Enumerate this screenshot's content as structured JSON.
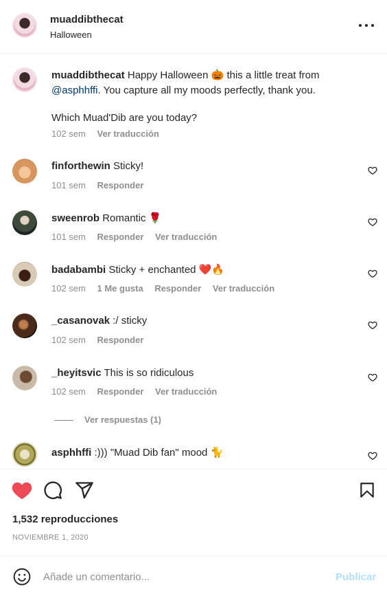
{
  "post": {
    "username": "muaddibthecat",
    "location": "Halloween"
  },
  "caption": {
    "username": "muaddibthecat",
    "text_1": "Happy Halloween",
    "emoji_1": "🎃",
    "text_2": "this a little treat from",
    "mention": "@asphhffi",
    "text_3": ". You capture all my moods perfectly, thank you.",
    "text_4": "Which Muad'Dib are you today?",
    "time": "102 sem",
    "translate": "Ver traducción"
  },
  "comments": [
    {
      "username": "finforthewin",
      "text": "Sticky!",
      "time": "101 sem",
      "reply": "Responder"
    },
    {
      "username": "sweenrob",
      "text": "Romantic",
      "emoji": "🌹",
      "time": "101 sem",
      "reply": "Responder",
      "translate": "Ver traducción"
    },
    {
      "username": "badabambi",
      "text": "Sticky + enchanted",
      "emoji": "❤️🔥",
      "time": "102 sem",
      "likes": "1 Me gusta",
      "reply": "Responder",
      "translate": "Ver traducción"
    },
    {
      "username": "_casanovak",
      "text": ":/ sticky",
      "time": "102 sem",
      "reply": "Responder"
    },
    {
      "username": "_heyitsvic",
      "text": "This is so ridiculous",
      "time": "102 sem",
      "reply": "Responder",
      "translate": "Ver traducción"
    },
    {
      "username": "asphhffi",
      "text": ":))) \"Muad Dib fan\" mood",
      "emoji": "🐈"
    }
  ],
  "view_replies": "Ver respuestas (1)",
  "actions": {
    "views": "1,532 reproducciones",
    "date": "NOVIEMBRE 1, 2020"
  },
  "add_comment": {
    "placeholder": "Añade un comentario...",
    "post_label": "Publicar"
  },
  "colors": {
    "like_red": "#ed4956",
    "link_blue": "#00376b",
    "publish_disabled": "#b2dffc"
  },
  "icons": [
    "more-icon",
    "heart-icon",
    "comment-icon",
    "share-icon",
    "bookmark-icon",
    "emoji-icon"
  ]
}
